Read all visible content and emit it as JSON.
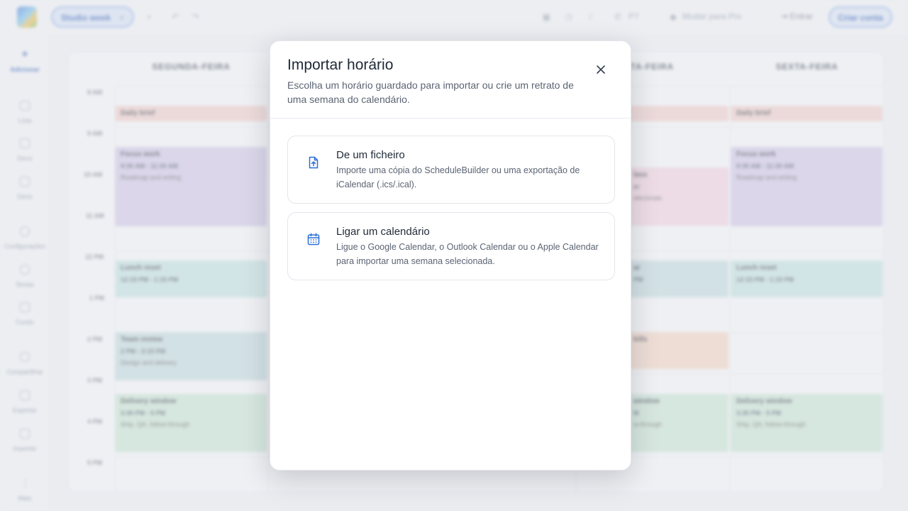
{
  "topbar": {
    "tab_label": "Studio week",
    "tab_close": "×",
    "add_tab": "+",
    "undo": "↶",
    "redo": "↷",
    "call_count": "P7",
    "upgrade_label": "Mudar para Pro",
    "signin_label": "Entrar",
    "signup_label": "Criar conta"
  },
  "sidebar": {
    "items": [
      {
        "icon": "plus-icon",
        "label": "Adicionar"
      },
      {
        "icon": "list-icon",
        "label": "Lista"
      },
      {
        "icon": "grid-icon",
        "label": "Dens"
      },
      {
        "icon": "calendar-icon",
        "label": "Dens"
      },
      {
        "icon": "gear-icon",
        "label": "Configurações"
      },
      {
        "icon": "palette-icon",
        "label": "Temas"
      },
      {
        "icon": "image-icon",
        "label": "Fundo"
      },
      {
        "icon": "share-icon",
        "label": "Compartilhar"
      },
      {
        "icon": "export-icon",
        "label": "Exportar"
      },
      {
        "icon": "import-icon",
        "label": "Importar"
      },
      {
        "icon": "more-icon",
        "label": "Mais"
      }
    ]
  },
  "calendar": {
    "days": [
      "SEGUNDA-FEIRA",
      "QUINTA-FEIRA",
      "SEXTA-FEIRA"
    ],
    "day_partial": "NTA-FEIRA",
    "times": [
      "8 AM",
      "9 AM",
      "10 AM",
      "11 AM",
      "12 PM",
      "1 PM",
      "2 PM",
      "3 PM",
      "4 PM",
      "5 PM"
    ],
    "events": {
      "daily_brief": "Daily brief",
      "focus_work": "Focus work",
      "focus_time": "9:30 AM - 11:30 AM",
      "focus_desc": "Roadmap and writing",
      "lunch_reset": "Lunch reset",
      "lunch_time": "12:15 PM - 1:15 PM",
      "team_review": "Team review",
      "team_time": "2 PM - 3:15 PM",
      "team_desc": "Design and delivery",
      "delivery_window": "Delivery window",
      "delivery_time": "3:30 PM - 5 PM",
      "delivery_desc": "Ship, QA, follow-through",
      "partial_class": "lass",
      "partial_cer": "er",
      "partial_cer_desc": "elecionais",
      "partial_lunch": "ar",
      "partial_lunch_time": "PM",
      "partial_skills": "kills",
      "partial_delivery": "window",
      "partial_delivery_time": "M",
      "partial_delivery_desc": "w-through"
    }
  },
  "modal": {
    "title": "Importar horário",
    "subtitle": "Escolha um horário guardado para importar ou crie um retrato de uma semana do calendário.",
    "close_icon": "close-icon",
    "options": [
      {
        "icon": "file-upload-icon",
        "title": "De um ficheiro",
        "description": "Importe uma cópia do ScheduleBuilder ou uma exportação de iCalendar (.ics/.ical)."
      },
      {
        "icon": "calendar-icon",
        "title": "Ligar um calendário",
        "description": "Ligue o Google Calendar, o Outlook Calendar ou o Apple Calendar para importar uma semana selecionada."
      }
    ]
  },
  "colors": {
    "accent": "#2d5bb8",
    "icon_blue": "#2a6fd6",
    "brief": "#f3d0cc",
    "focus": "#d3c9ea",
    "lunch": "#c4e3e2",
    "review": "#c4dde0",
    "delivery": "#cbe7d6",
    "skills": "#f5d6c4",
    "class": "#f4d3e0"
  }
}
